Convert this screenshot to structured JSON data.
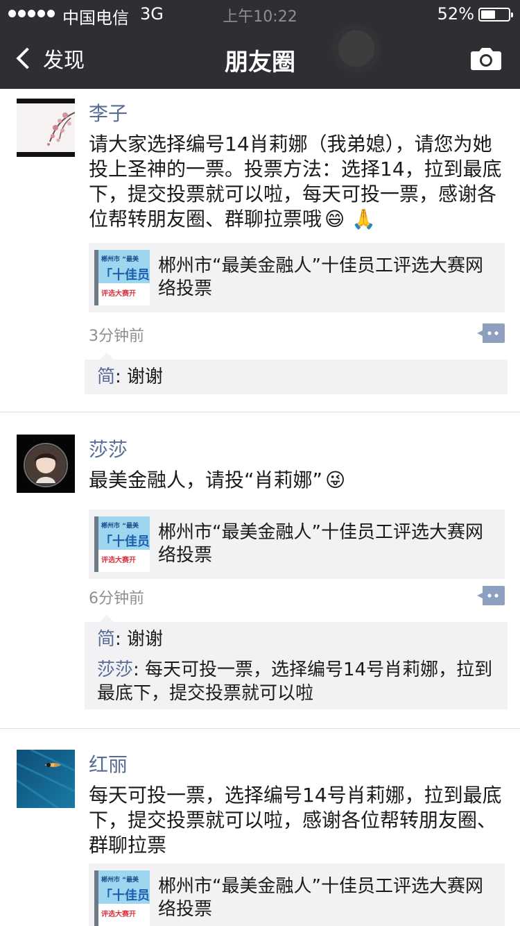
{
  "status_bar": {
    "carrier": "中国电信",
    "network": "3G",
    "time": "上午10:22",
    "battery_percent": "52%",
    "battery_level": 0.52
  },
  "nav": {
    "back_label": "发现",
    "title": "朋友圈",
    "camera_icon": "camera-icon"
  },
  "posts": [
    {
      "name": "李子",
      "text": "请大家选择编号14肖莉娜（我弟媳），请您为她投上圣神的一票。投票方法：选择14，拉到最底下，提交投票就可以啦，每天可投一票，感谢各位帮转朋友圈、群聊拉票哦",
      "emoji": [
        "😄",
        "🙏"
      ],
      "link_title": "郴州市“最美金融人”十佳员工评选大赛网络投票",
      "link_thumb_text": {
        "top": "郴州市 “最美",
        "mid": "「十佳员",
        "bottom": "评选大赛开"
      },
      "time": "3分钟前",
      "comments": [
        {
          "author": "简",
          "sep": ": ",
          "text": "谢谢"
        }
      ]
    },
    {
      "name": "莎莎",
      "text": "最美金融人，请投“肖莉娜”",
      "emoji": [
        "😜"
      ],
      "link_title": "郴州市“最美金融人”十佳员工评选大赛网络投票",
      "link_thumb_text": {
        "top": "郴州市 “最美",
        "mid": "「十佳员",
        "bottom": "评选大赛开"
      },
      "time": "6分钟前",
      "comments": [
        {
          "author": "简",
          "sep": ": ",
          "text": "谢谢"
        },
        {
          "author": "莎莎",
          "sep": ": ",
          "text": "每天可投一票，选择编号14号肖莉娜，拉到最底下，提交投票就可以啦"
        }
      ]
    },
    {
      "name": "红丽",
      "text": "每天可投一票，选择编号14号肖莉娜，拉到最底下，提交投票就可以啦，感谢各位帮转朋友圈、群聊拉票",
      "link_title": "郴州市“最美金融人”十佳员工评选大赛网络投票",
      "link_thumb_text": {
        "top": "郴州市 “最美",
        "mid": "「十佳员",
        "bottom": "评选大赛开"
      }
    }
  ]
}
